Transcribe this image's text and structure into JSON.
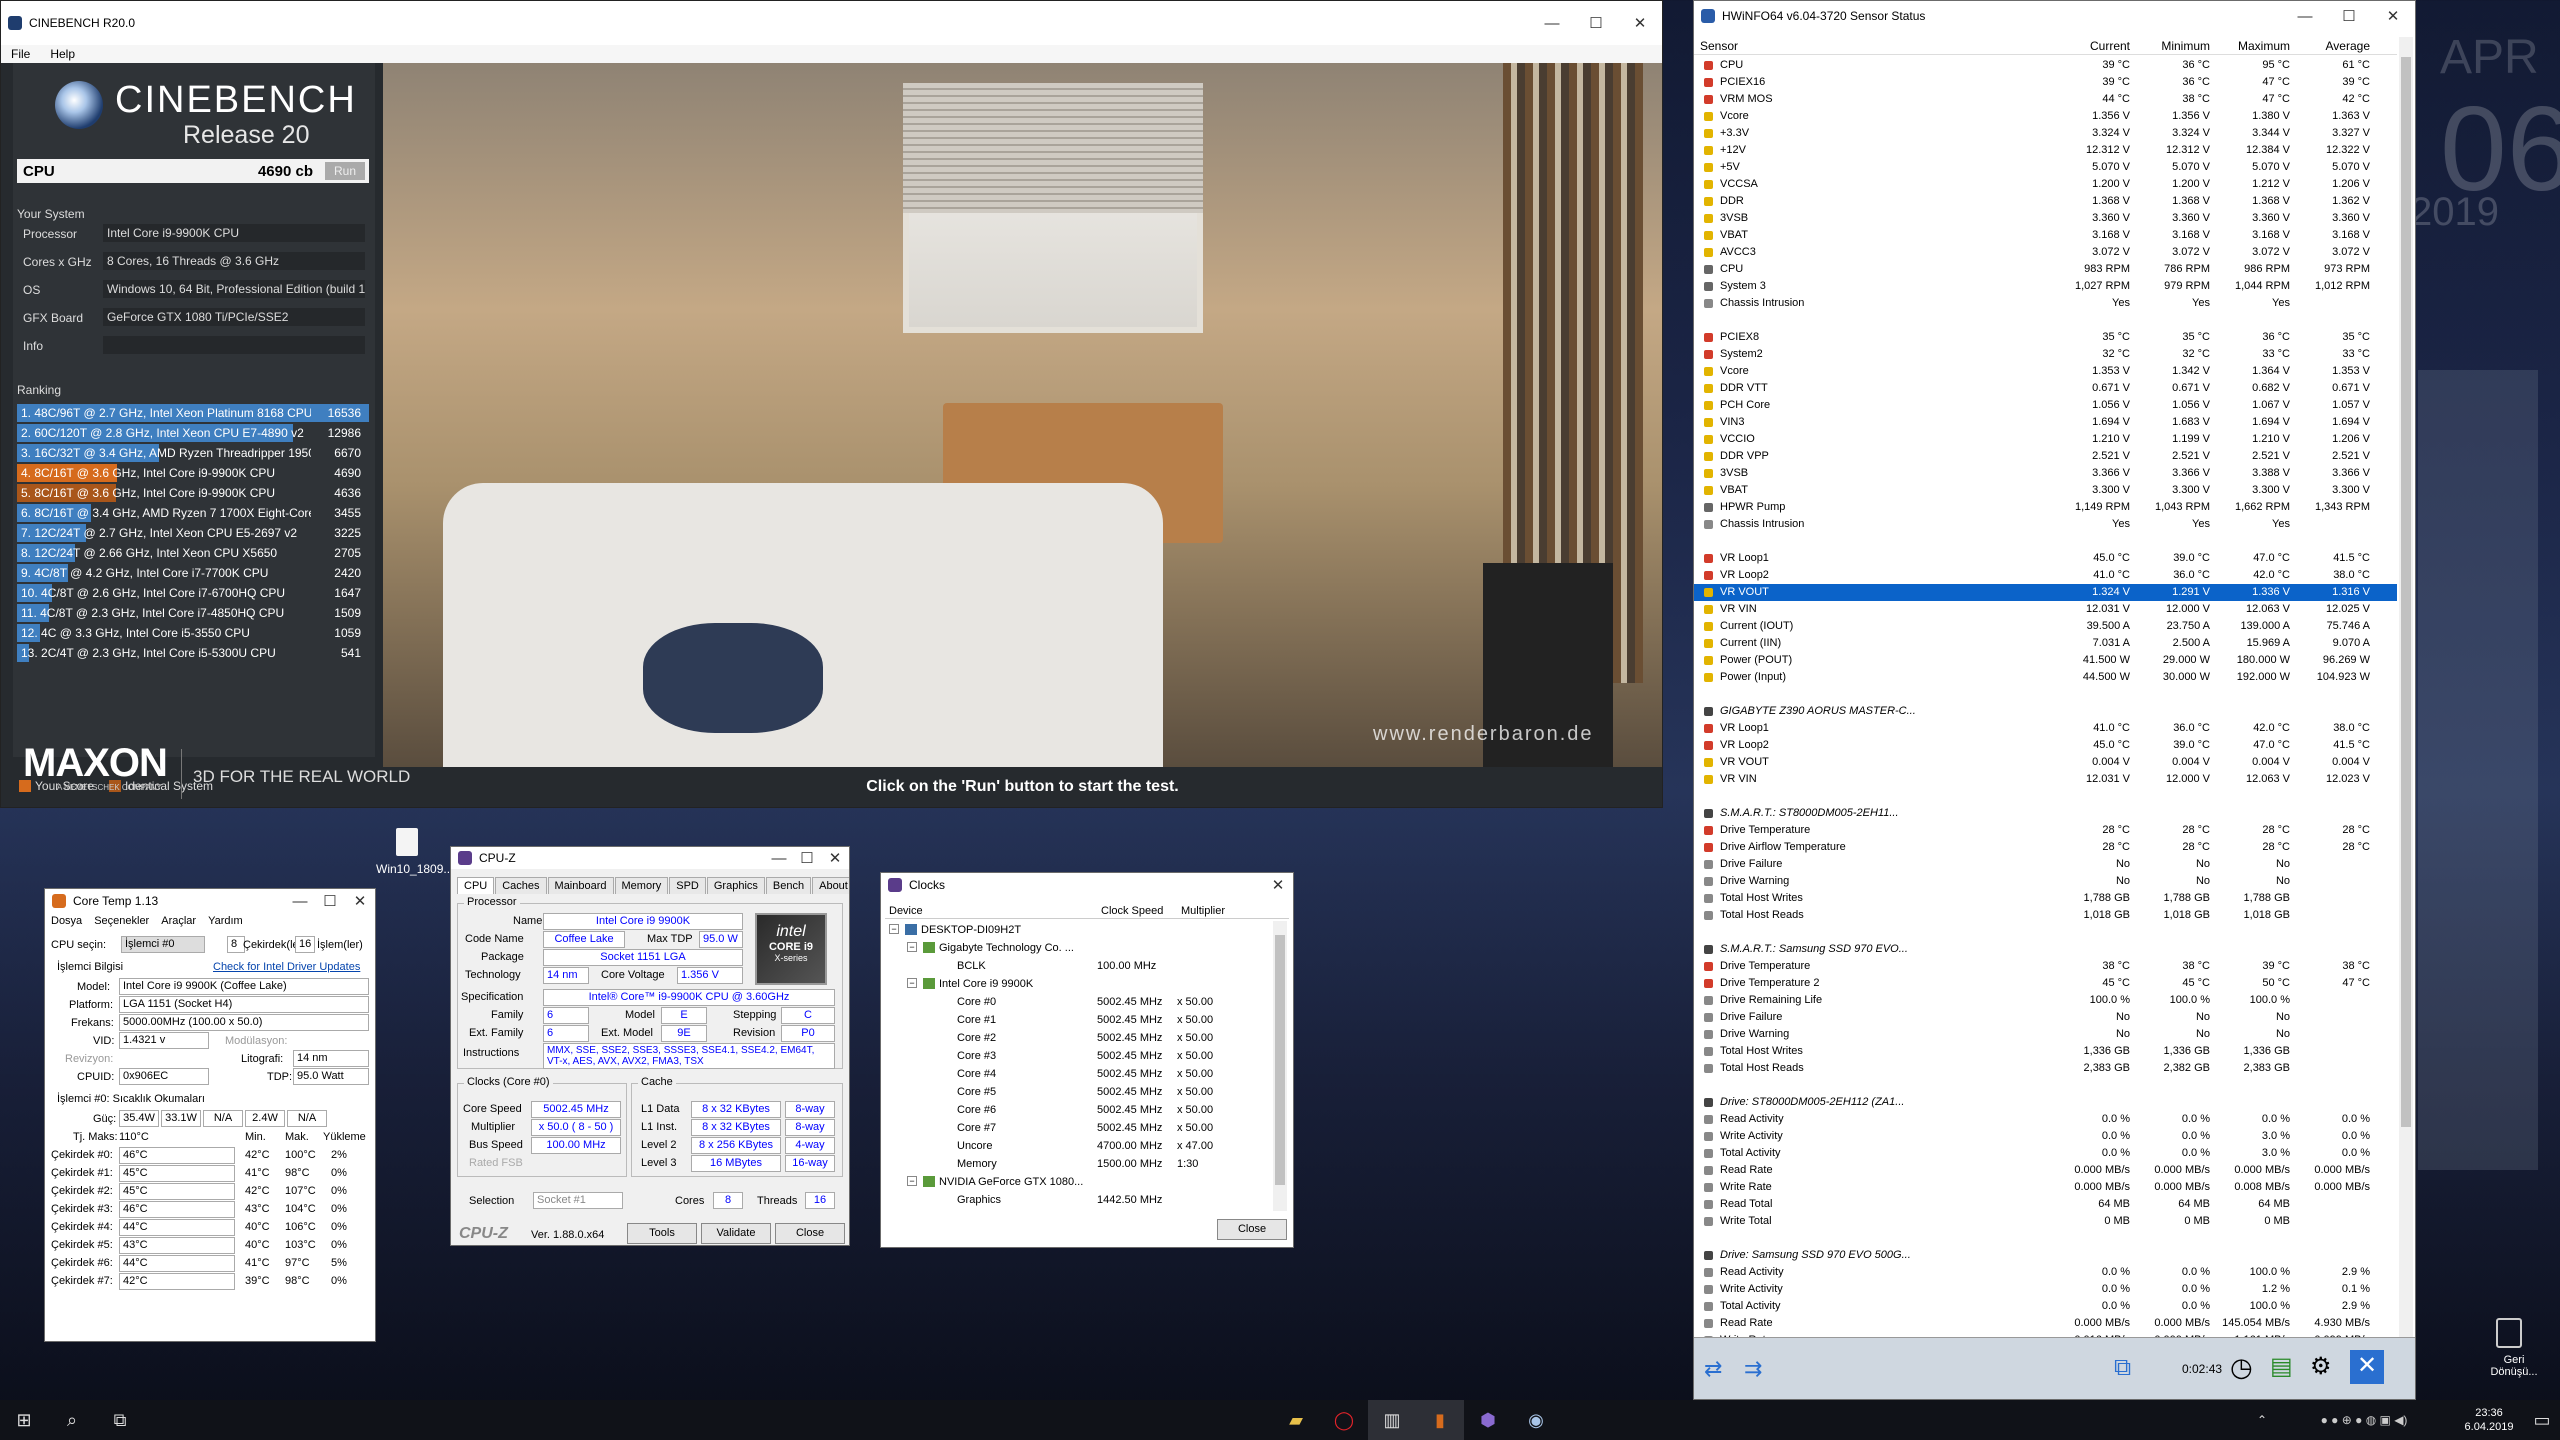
{
  "cinebench": {
    "title": "CINEBENCH R20.0",
    "menu": [
      "File",
      "Help"
    ],
    "brand": "CINEBENCH",
    "release": "Release 20",
    "cpu_label": "CPU",
    "cpu_score": "4690 cb",
    "run": "Run",
    "your_system": "Your System",
    "system": [
      {
        "k": "Processor",
        "v": "Intel Core i9-9900K CPU"
      },
      {
        "k": "Cores x GHz",
        "v": "8 Cores, 16 Threads @ 3.6 GHz"
      },
      {
        "k": "OS",
        "v": "Windows 10, 64 Bit, Professional Edition (build 1"
      },
      {
        "k": "GFX Board",
        "v": "GeForce GTX 1080 Ti/PCIe/SSE2"
      },
      {
        "k": "Info",
        "v": ""
      }
    ],
    "ranking_label": "Ranking",
    "ranking": [
      {
        "label": "1. 48C/96T @ 2.7 GHz, Intel Xeon Platinum 8168 CPU",
        "score": "16536",
        "bar": 1.0,
        "type": "other"
      },
      {
        "label": "2. 60C/120T @ 2.8 GHz, Intel Xeon CPU E7-4890 v2",
        "score": "12986",
        "bar": 0.785,
        "type": "other"
      },
      {
        "label": "3. 16C/32T @ 3.4 GHz, AMD Ryzen Threadripper 1950X",
        "score": "6670",
        "bar": 0.403,
        "type": "other"
      },
      {
        "label": "4. 8C/16T @ 3.6 GHz, Intel Core i9-9900K CPU",
        "score": "4690",
        "bar": 0.284,
        "type": "mine"
      },
      {
        "label": "5. 8C/16T @ 3.6 GHz, Intel Core i9-9900K CPU",
        "score": "4636",
        "bar": 0.28,
        "type": "identical"
      },
      {
        "label": "6. 8C/16T @ 3.4 GHz, AMD Ryzen 7 1700X Eight-Core Pr",
        "score": "3455",
        "bar": 0.209,
        "type": "other"
      },
      {
        "label": "7. 12C/24T @ 2.7 GHz, Intel Xeon CPU E5-2697 v2",
        "score": "3225",
        "bar": 0.195,
        "type": "other"
      },
      {
        "label": "8. 12C/24T @ 2.66 GHz, Intel Xeon CPU X5650",
        "score": "2705",
        "bar": 0.164,
        "type": "other"
      },
      {
        "label": "9. 4C/8T @ 4.2 GHz, Intel Core i7-7700K CPU",
        "score": "2420",
        "bar": 0.146,
        "type": "other"
      },
      {
        "label": "10. 4C/8T @ 2.6 GHz, Intel Core i7-6700HQ CPU",
        "score": "1647",
        "bar": 0.1,
        "type": "other"
      },
      {
        "label": "11. 4C/8T @ 2.3 GHz, Intel Core i7-4850HQ CPU",
        "score": "1509",
        "bar": 0.091,
        "type": "other"
      },
      {
        "label": "12. 4C @ 3.3 GHz, Intel Core i5-3550 CPU",
        "score": "1059",
        "bar": 0.064,
        "type": "other"
      },
      {
        "label": "13. 2C/4T @ 2.3 GHz, Intel Core i5-5300U CPU",
        "score": "541",
        "bar": 0.033,
        "type": "other"
      }
    ],
    "legend_mine": "Your Score",
    "legend_identical": "Identical System",
    "maxon": "MAXON",
    "maxon_sub": "A NEMETSCHEK COMPANY",
    "tagline": "3D FOR THE REAL WORLD",
    "watermark": "www.renderbaron.de",
    "run_message": "Click on the 'Run' button to start the test."
  },
  "hwinfo": {
    "title": "HWiNFO64 v6.04-3720 Sensor Status",
    "headers": [
      "Sensor",
      "Current",
      "Minimum",
      "Maximum",
      "Average"
    ],
    "rows": [
      [
        "CPU",
        "39 °C",
        "36 °C",
        "95 °C",
        "61 °C",
        "t"
      ],
      [
        "PCIEX16",
        "39 °C",
        "36 °C",
        "47 °C",
        "39 °C",
        "t"
      ],
      [
        "VRM MOS",
        "44 °C",
        "38 °C",
        "47 °C",
        "42 °C",
        "t"
      ],
      [
        "Vcore",
        "1.356 V",
        "1.356 V",
        "1.380 V",
        "1.363 V",
        "v"
      ],
      [
        "+3.3V",
        "3.324 V",
        "3.324 V",
        "3.344 V",
        "3.327 V",
        "v"
      ],
      [
        "+12V",
        "12.312 V",
        "12.312 V",
        "12.384 V",
        "12.322 V",
        "v"
      ],
      [
        "+5V",
        "5.070 V",
        "5.070 V",
        "5.070 V",
        "5.070 V",
        "v"
      ],
      [
        "VCCSA",
        "1.200 V",
        "1.200 V",
        "1.212 V",
        "1.206 V",
        "v"
      ],
      [
        "DDR",
        "1.368 V",
        "1.368 V",
        "1.368 V",
        "1.362 V",
        "v"
      ],
      [
        "3VSB",
        "3.360 V",
        "3.360 V",
        "3.360 V",
        "3.360 V",
        "v"
      ],
      [
        "VBAT",
        "3.168 V",
        "3.168 V",
        "3.168 V",
        "3.168 V",
        "v"
      ],
      [
        "AVCC3",
        "3.072 V",
        "3.072 V",
        "3.072 V",
        "3.072 V",
        "v"
      ],
      [
        "CPU",
        "983 RPM",
        "786 RPM",
        "986 RPM",
        "973 RPM",
        "f"
      ],
      [
        "System 3",
        "1,027 RPM",
        "979 RPM",
        "1,044 RPM",
        "1,012 RPM",
        "f"
      ],
      [
        "Chassis Intrusion",
        "Yes",
        "Yes",
        "Yes",
        "",
        "o"
      ],
      [
        "",
        "",
        "",
        "",
        "",
        "b"
      ],
      [
        "PCIEX8",
        "35 °C",
        "35 °C",
        "36 °C",
        "35 °C",
        "t"
      ],
      [
        "System2",
        "32 °C",
        "32 °C",
        "33 °C",
        "33 °C",
        "t"
      ],
      [
        "Vcore",
        "1.353 V",
        "1.342 V",
        "1.364 V",
        "1.353 V",
        "v"
      ],
      [
        "DDR VTT",
        "0.671 V",
        "0.671 V",
        "0.682 V",
        "0.671 V",
        "v"
      ],
      [
        "PCH Core",
        "1.056 V",
        "1.056 V",
        "1.067 V",
        "1.057 V",
        "v"
      ],
      [
        "VIN3",
        "1.694 V",
        "1.683 V",
        "1.694 V",
        "1.694 V",
        "v"
      ],
      [
        "VCCIO",
        "1.210 V",
        "1.199 V",
        "1.210 V",
        "1.206 V",
        "v"
      ],
      [
        "DDR VPP",
        "2.521 V",
        "2.521 V",
        "2.521 V",
        "2.521 V",
        "v"
      ],
      [
        "3VSB",
        "3.366 V",
        "3.366 V",
        "3.388 V",
        "3.366 V",
        "v"
      ],
      [
        "VBAT",
        "3.300 V",
        "3.300 V",
        "3.300 V",
        "3.300 V",
        "v"
      ],
      [
        "HPWR Pump",
        "1,149 RPM",
        "1,043 RPM",
        "1,662 RPM",
        "1,343 RPM",
        "f"
      ],
      [
        "Chassis Intrusion",
        "Yes",
        "Yes",
        "Yes",
        "",
        "o"
      ],
      [
        "",
        "",
        "",
        "",
        "",
        "b"
      ],
      [
        "VR Loop1",
        "45.0 °C",
        "39.0 °C",
        "47.0 °C",
        "41.5 °C",
        "t"
      ],
      [
        "VR Loop2",
        "41.0 °C",
        "36.0 °C",
        "42.0 °C",
        "38.0 °C",
        "t"
      ],
      [
        "VR VOUT",
        "1.324 V",
        "1.291 V",
        "1.336 V",
        "1.316 V",
        "sel"
      ],
      [
        "VR VIN",
        "12.031 V",
        "12.000 V",
        "12.063 V",
        "12.025 V",
        "v"
      ],
      [
        "Current (IOUT)",
        "39.500 A",
        "23.750 A",
        "139.000 A",
        "75.746 A",
        "v"
      ],
      [
        "Current (IIN)",
        "7.031 A",
        "2.500 A",
        "15.969 A",
        "9.070 A",
        "v"
      ],
      [
        "Power (POUT)",
        "41.500 W",
        "29.000 W",
        "180.000 W",
        "96.269 W",
        "v"
      ],
      [
        "Power (Input)",
        "44.500 W",
        "30.000 W",
        "192.000 W",
        "104.923 W",
        "v"
      ],
      [
        "",
        "",
        "",
        "",
        "",
        "b"
      ],
      [
        "GIGABYTE Z390 AORUS MASTER-C...",
        "",
        "",
        "",
        "",
        "g"
      ],
      [
        "VR Loop1",
        "41.0 °C",
        "36.0 °C",
        "42.0 °C",
        "38.0 °C",
        "t"
      ],
      [
        "VR Loop2",
        "45.0 °C",
        "39.0 °C",
        "47.0 °C",
        "41.5 °C",
        "t"
      ],
      [
        "VR VOUT",
        "0.004 V",
        "0.004 V",
        "0.004 V",
        "0.004 V",
        "v"
      ],
      [
        "VR VIN",
        "12.031 V",
        "12.000 V",
        "12.063 V",
        "12.023 V",
        "v"
      ],
      [
        "",
        "",
        "",
        "",
        "",
        "b"
      ],
      [
        "S.M.A.R.T.: ST8000DM005-2EH11...",
        "",
        "",
        "",
        "",
        "g"
      ],
      [
        "Drive Temperature",
        "28 °C",
        "28 °C",
        "28 °C",
        "28 °C",
        "t"
      ],
      [
        "Drive Airflow Temperature",
        "28 °C",
        "28 °C",
        "28 °C",
        "28 °C",
        "t"
      ],
      [
        "Drive Failure",
        "No",
        "No",
        "No",
        "",
        "o"
      ],
      [
        "Drive Warning",
        "No",
        "No",
        "No",
        "",
        "o"
      ],
      [
        "Total Host Writes",
        "1,788 GB",
        "1,788 GB",
        "1,788 GB",
        "",
        "o"
      ],
      [
        "Total Host Reads",
        "1,018 GB",
        "1,018 GB",
        "1,018 GB",
        "",
        "o"
      ],
      [
        "",
        "",
        "",
        "",
        "",
        "b"
      ],
      [
        "S.M.A.R.T.: Samsung SSD 970 EVO...",
        "",
        "",
        "",
        "",
        "g"
      ],
      [
        "Drive Temperature",
        "38 °C",
        "38 °C",
        "39 °C",
        "38 °C",
        "t"
      ],
      [
        "Drive Temperature 2",
        "45 °C",
        "45 °C",
        "50 °C",
        "47 °C",
        "t"
      ],
      [
        "Drive Remaining Life",
        "100.0 %",
        "100.0 %",
        "100.0 %",
        "",
        "o"
      ],
      [
        "Drive Failure",
        "No",
        "No",
        "No",
        "",
        "o"
      ],
      [
        "Drive Warning",
        "No",
        "No",
        "No",
        "",
        "o"
      ],
      [
        "Total Host Writes",
        "1,336 GB",
        "1,336 GB",
        "1,336 GB",
        "",
        "o"
      ],
      [
        "Total Host Reads",
        "2,383 GB",
        "2,382 GB",
        "2,383 GB",
        "",
        "o"
      ],
      [
        "",
        "",
        "",
        "",
        "",
        "b"
      ],
      [
        "Drive: ST8000DM005-2EH112 (ZA1...",
        "",
        "",
        "",
        "",
        "g"
      ],
      [
        "Read Activity",
        "0.0 %",
        "0.0 %",
        "0.0 %",
        "0.0 %",
        "o"
      ],
      [
        "Write Activity",
        "0.0 %",
        "0.0 %",
        "3.0 %",
        "0.0 %",
        "o"
      ],
      [
        "Total Activity",
        "0.0 %",
        "0.0 %",
        "3.0 %",
        "0.0 %",
        "o"
      ],
      [
        "Read Rate",
        "0.000 MB/s",
        "0.000 MB/s",
        "0.000 MB/s",
        "0.000 MB/s",
        "o"
      ],
      [
        "Write Rate",
        "0.000 MB/s",
        "0.000 MB/s",
        "0.008 MB/s",
        "0.000 MB/s",
        "o"
      ],
      [
        "Read Total",
        "64 MB",
        "64 MB",
        "64 MB",
        "",
        "o"
      ],
      [
        "Write Total",
        "0 MB",
        "0 MB",
        "0 MB",
        "",
        "o"
      ],
      [
        "",
        "",
        "",
        "",
        "",
        "b"
      ],
      [
        "Drive: Samsung SSD 970 EVO 500G...",
        "",
        "",
        "",
        "",
        "g"
      ],
      [
        "Read Activity",
        "0.0 %",
        "0.0 %",
        "100.0 %",
        "2.9 %",
        "o"
      ],
      [
        "Write Activity",
        "0.0 %",
        "0.0 %",
        "1.2 %",
        "0.1 %",
        "o"
      ],
      [
        "Total Activity",
        "0.0 %",
        "0.0 %",
        "100.0 %",
        "2.9 %",
        "o"
      ],
      [
        "Read Rate",
        "0.000 MB/s",
        "0.000 MB/s",
        "145.054 MB/s",
        "4.930 MB/s",
        "o"
      ],
      [
        "Write Rate",
        "0.016 MB/s",
        "0.000 MB/s",
        "1.161 MB/s",
        "0.099 MB/s",
        "o"
      ]
    ],
    "timer": "0:02:43"
  },
  "coretemp": {
    "title": "Core Temp 1.13",
    "menu": [
      "Dosya",
      "Seçenekler",
      "Araçlar",
      "Yardım"
    ],
    "cpu_select_label": "CPU seçin:",
    "cpu_select": "İşlemci #0",
    "cores_val": "8",
    "cores_label": "Çekirdek(ler)",
    "threads_val": "16",
    "threads_label": "İşlem(ler)",
    "info_label": "İşlemci Bilgisi",
    "update_link": "Check for Intel Driver Updates",
    "model_label": "Model:",
    "model": "Intel Core i9 9900K (Coffee Lake)",
    "platform_label": "Platform:",
    "platform": "LGA 1151 (Socket H4)",
    "freq_label": "Frekans:",
    "freq": "5000.00MHz (100.00 x 50.0)",
    "vid_label": "VID:",
    "vid": "1.4321 v",
    "mod_label": "Modülasyon:",
    "rev_label": "Revizyon:",
    "litho_label": "Litografi:",
    "litho": "14 nm",
    "cpuid_label": "CPUID:",
    "cpuid": "0x906EC",
    "tdp_label": "TDP:",
    "tdp": "95.0 Watt",
    "temp_header": "İşlemci #0: Sıcaklık Okumaları",
    "power_label": "Güç:",
    "power": [
      "35.4W",
      "33.1W",
      "N/A",
      "2.4W",
      "N/A"
    ],
    "tjmax_label": "Tj. Maks:",
    "tjmax": "110°C",
    "col_min": "Min.",
    "col_max": "Mak.",
    "col_load": "Yükleme",
    "cores": [
      {
        "n": "Çekirdek #0:",
        "t": "46°C",
        "min": "42°C",
        "max": "100°C",
        "load": "2%"
      },
      {
        "n": "Çekirdek #1:",
        "t": "45°C",
        "min": "41°C",
        "max": "98°C",
        "load": "0%"
      },
      {
        "n": "Çekirdek #2:",
        "t": "45°C",
        "min": "42°C",
        "max": "107°C",
        "load": "0%"
      },
      {
        "n": "Çekirdek #3:",
        "t": "46°C",
        "min": "43°C",
        "max": "104°C",
        "load": "0%"
      },
      {
        "n": "Çekirdek #4:",
        "t": "44°C",
        "min": "40°C",
        "max": "106°C",
        "load": "0%"
      },
      {
        "n": "Çekirdek #5:",
        "t": "43°C",
        "min": "40°C",
        "max": "103°C",
        "load": "0%"
      },
      {
        "n": "Çekirdek #6:",
        "t": "44°C",
        "min": "41°C",
        "max": "97°C",
        "load": "5%"
      },
      {
        "n": "Çekirdek #7:",
        "t": "42°C",
        "min": "39°C",
        "max": "98°C",
        "load": "0%"
      }
    ]
  },
  "cpuz": {
    "title": "CPU-Z",
    "tabs": [
      "CPU",
      "Caches",
      "Mainboard",
      "Memory",
      "SPD",
      "Graphics",
      "Bench",
      "About"
    ],
    "processor_group": "Processor",
    "name_label": "Name",
    "name": "Intel Core i9 9900K",
    "codename_label": "Code Name",
    "codename": "Coffee Lake",
    "maxtdp_label": "Max TDP",
    "maxtdp": "95.0 W",
    "package_label": "Package",
    "package": "Socket 1151 LGA",
    "tech_label": "Technology",
    "tech": "14 nm",
    "cv_label": "Core Voltage",
    "cv": "1.356 V",
    "spec_label": "Specification",
    "spec": "Intel® Core™ i9-9900K CPU @ 3.60GHz",
    "family_label": "Family",
    "family": "6",
    "model_label": "Model",
    "model": "E",
    "stepping_label": "Stepping",
    "stepping": "C",
    "extfam_label": "Ext. Family",
    "extfam": "6",
    "extmodel_label": "Ext. Model",
    "extmodel": "9E",
    "revision_label": "Revision",
    "revision": "P0",
    "instr_label": "Instructions",
    "instr": "MMX, SSE, SSE2, SSE3, SSSE3, SSE4.1, SSE4.2, EM64T, VT-x, AES, AVX, AVX2, FMA3, TSX",
    "clocks_group": "Clocks (Core #0)",
    "cache_group": "Cache",
    "corespeed_label": "Core Speed",
    "corespeed": "5002.45 MHz",
    "mult_label": "Multiplier",
    "mult": "x 50.0 ( 8 - 50 )",
    "bus_label": "Bus Speed",
    "bus": "100.00 MHz",
    "fsb_label": "Rated FSB",
    "l1d_label": "L1 Data",
    "l1d": "8 x 32 KBytes",
    "l1d_way": "8-way",
    "l1i_label": "L1 Inst.",
    "l1i": "8 x 32 KBytes",
    "l1i_way": "8-way",
    "l2_label": "Level 2",
    "l2": "8 x 256 KBytes",
    "l2_way": "4-way",
    "l3_label": "Level 3",
    "l3": "16 MBytes",
    "l3_way": "16-way",
    "selection_label": "Selection",
    "selection": "Socket #1",
    "cores_label": "Cores",
    "cores": "8",
    "threads_label": "Threads",
    "threads": "16",
    "brand": "CPU-Z",
    "version": "Ver. 1.88.0.x64",
    "tools": "Tools",
    "validate": "Validate",
    "close": "Close",
    "logo_text": "intel",
    "logo_sub": "CORE i9",
    "logo_sub2": "X-series"
  },
  "clocks": {
    "title": "Clocks",
    "headers": [
      "Device",
      "Clock Speed",
      "Multiplier"
    ],
    "tree": [
      {
        "name": "DESKTOP-DI09H2T",
        "clock": "",
        "mult": "",
        "level": 0
      },
      {
        "name": "Gigabyte Technology Co. ...",
        "clock": "",
        "mult": "",
        "level": 1
      },
      {
        "name": "BCLK",
        "clock": "100.00 MHz",
        "mult": "",
        "level": 2
      },
      {
        "name": "Intel Core i9 9900K",
        "clock": "",
        "mult": "",
        "level": 1
      },
      {
        "name": "Core #0",
        "clock": "5002.45 MHz",
        "mult": "x 50.00",
        "level": 2
      },
      {
        "name": "Core #1",
        "clock": "5002.45 MHz",
        "mult": "x 50.00",
        "level": 2
      },
      {
        "name": "Core #2",
        "clock": "5002.45 MHz",
        "mult": "x 50.00",
        "level": 2
      },
      {
        "name": "Core #3",
        "clock": "5002.45 MHz",
        "mult": "x 50.00",
        "level": 2
      },
      {
        "name": "Core #4",
        "clock": "5002.45 MHz",
        "mult": "x 50.00",
        "level": 2
      },
      {
        "name": "Core #5",
        "clock": "5002.45 MHz",
        "mult": "x 50.00",
        "level": 2
      },
      {
        "name": "Core #6",
        "clock": "5002.45 MHz",
        "mult": "x 50.00",
        "level": 2
      },
      {
        "name": "Core #7",
        "clock": "5002.45 MHz",
        "mult": "x 50.00",
        "level": 2
      },
      {
        "name": "Uncore",
        "clock": "4700.00 MHz",
        "mult": "x 47.00",
        "level": 2
      },
      {
        "name": "Memory",
        "clock": "1500.00 MHz",
        "mult": "1:30",
        "level": 2
      },
      {
        "name": "NVIDIA GeForce GTX 1080...",
        "clock": "",
        "mult": "",
        "level": 1
      },
      {
        "name": "Graphics",
        "clock": "1442.50 MHz",
        "mult": "",
        "level": 2
      }
    ],
    "close": "Close"
  },
  "desktop": {
    "file_label": "Win10_1809...",
    "date_big": "06",
    "date_month": "APR",
    "date_year": "2019",
    "side_text": "Re",
    "side_text2": "H",
    "recycle": "Geri Dönüşü...",
    "clock_time": "23:36",
    "clock_date": "6.04.2019",
    "colors": {
      "accent": "#0b63c9",
      "cb_orange": "#d66b1d",
      "cb_blue": "#3f7fc0"
    }
  }
}
